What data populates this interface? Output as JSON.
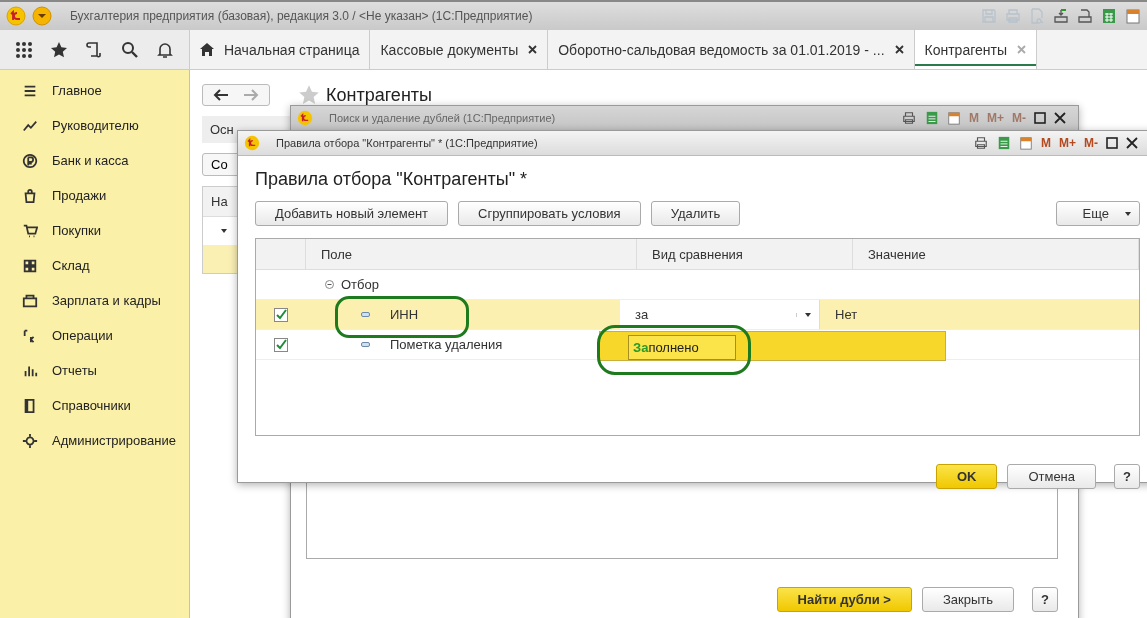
{
  "app": {
    "title": "Бухгалтерия предприятия (базовая), редакция 3.0 / <Не указан>  (1С:Предприятие)"
  },
  "tabs": [
    {
      "label": "Начальная страница",
      "selected": false,
      "kind": "home"
    },
    {
      "label": "Кассовые документы",
      "selected": false,
      "kind": "closable"
    },
    {
      "label": "Оборотно-сальдовая ведомость за 01.01.2019 - ...",
      "selected": false,
      "kind": "closable"
    },
    {
      "label": "Контрагенты",
      "selected": true,
      "kind": "closable"
    }
  ],
  "sidebar": {
    "items": [
      {
        "label": "Главное"
      },
      {
        "label": "Руководителю"
      },
      {
        "label": "Банк и касса"
      },
      {
        "label": "Продажи"
      },
      {
        "label": "Покупки"
      },
      {
        "label": "Склад"
      },
      {
        "label": "Зарплата и кадры"
      },
      {
        "label": "Операции"
      },
      {
        "label": "Отчеты"
      },
      {
        "label": "Справочники"
      },
      {
        "label": "Администрирование"
      }
    ]
  },
  "background_form": {
    "title": "Контрагенты",
    "button_1": "Осн",
    "button_2": "Со",
    "column_1": "На"
  },
  "duplicates_window": {
    "title": "Поиск и удаление дублей  (1С:Предприятие)",
    "memory_buttons": [
      {
        "label": "M",
        "disabled": true
      },
      {
        "label": "M+",
        "disabled": true
      },
      {
        "label": "M-",
        "disabled": true
      }
    ],
    "buttons": [
      {
        "label": "Найти дубли >",
        "default": true
      },
      {
        "label": "Закрыть",
        "default": false
      }
    ],
    "help": "?"
  },
  "filter_dialog": {
    "title": "Правила отбора \"Контрагенты\" *  (1С:Предприятие)",
    "memory_buttons": [
      {
        "label": "M",
        "disabled": false
      },
      {
        "label": "M+",
        "disabled": false
      },
      {
        "label": "M-",
        "disabled": false
      }
    ],
    "heading": "Правила отбора \"Контрагенты\" *",
    "toolbar": [
      "Добавить новый элемент",
      "Сгруппировать условия",
      "Удалить"
    ],
    "more": "Еще",
    "columns": [
      "Поле",
      "Вид сравнения",
      "Значение"
    ],
    "group": {
      "label": "Отбор",
      "expanded": true,
      "children": [
        {
          "field": "ИНН",
          "checked": true,
          "selected": true,
          "comparison": "за",
          "value": "Нет"
        },
        {
          "field": "Пометка удаления",
          "checked": true,
          "selected": false
        }
      ]
    },
    "dropdown": {
      "options": [
        {
          "label": "**За**полнено",
          "selected": true
        }
      ]
    },
    "buttons": [
      {
        "label": "OK",
        "default": true
      },
      {
        "label": "Отмена",
        "default": false
      }
    ],
    "help": "?"
  }
}
